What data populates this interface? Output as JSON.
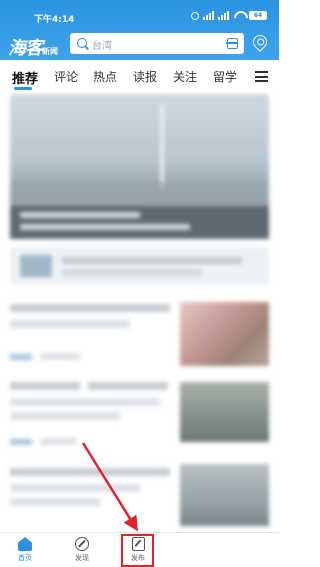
{
  "status_bar": {
    "time": "下午4:14",
    "battery": "64"
  },
  "app": {
    "logo_main": "海客",
    "logo_sub": "新闻"
  },
  "search": {
    "placeholder": "台湾"
  },
  "tabs": [
    {
      "label": "推荐",
      "active": true
    },
    {
      "label": "评论"
    },
    {
      "label": "热点"
    },
    {
      "label": "读报"
    },
    {
      "label": "关注"
    },
    {
      "label": "留学"
    }
  ],
  "bottom_nav": {
    "items": [
      {
        "label": "首页",
        "icon": "home-icon",
        "active": true
      },
      {
        "label": "发现",
        "icon": "compass-icon"
      },
      {
        "label": "发布",
        "icon": "publish-icon",
        "highlighted": true
      }
    ]
  },
  "colors": {
    "accent": "#2a93e0",
    "highlight": "#e8202a"
  }
}
